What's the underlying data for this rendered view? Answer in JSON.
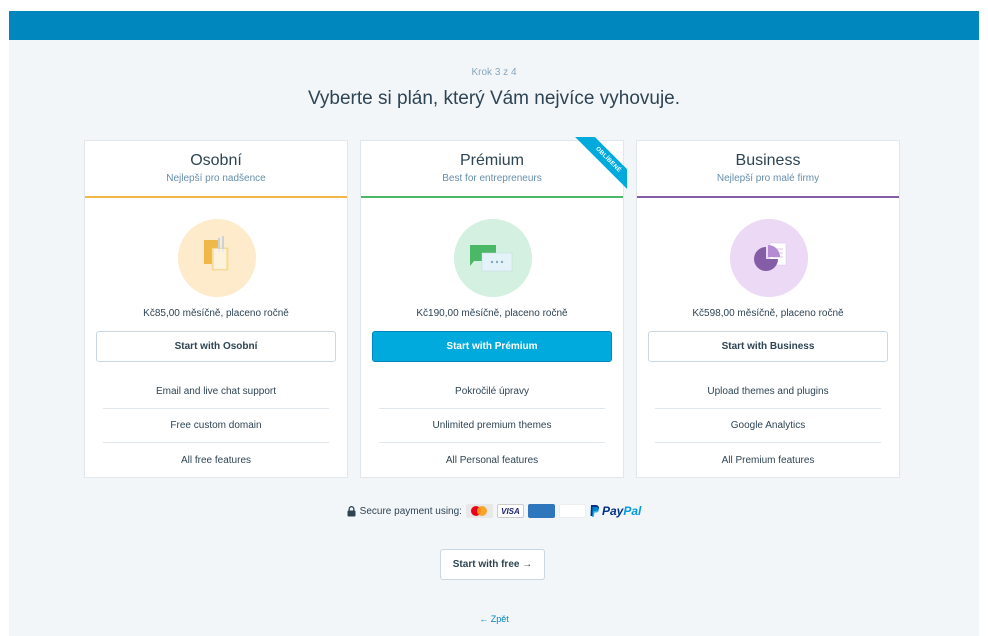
{
  "step": "Krok 3 z 4",
  "headline": "Vyberte si plán, který Vám nejvíce vyhovuje.",
  "plans": [
    {
      "name": "Osobní",
      "tagline": "Nejlepší pro nadšence",
      "price": "Kč85,00 měsíčně, placeno ročně",
      "button": "Start with Osobní",
      "accent": "#f0b849",
      "icon": "sticky-notes-icon",
      "features": [
        "Email and live chat support",
        "Free custom domain",
        "All free features"
      ]
    },
    {
      "name": "Prémium",
      "tagline": "Best for entrepreneurs",
      "price": "Kč190,00 měsíčně, placeno ročně",
      "button": "Start with Prémium",
      "accent": "#4ab866",
      "icon": "chat-bubbles-icon",
      "ribbon": "OBLÍBENÉ",
      "features": [
        "Pokročilé úpravy",
        "Unlimited premium themes",
        "All Personal features"
      ]
    },
    {
      "name": "Business",
      "tagline": "Nejlepší pro malé firmy",
      "price": "Kč598,00 měsíčně, placeno ročně",
      "button": "Start with Business",
      "accent": "#855da6",
      "icon": "pie-chart-document-icon",
      "features": [
        "Upload themes and plugins",
        "Google Analytics",
        "All Premium features"
      ]
    }
  ],
  "payment": {
    "label": "Secure payment using:",
    "methods": [
      "MasterCard",
      "VISA",
      "AMERICAN EXPRESS",
      "DISCOVER",
      "PayPal"
    ],
    "paypal_pay": "Pay",
    "paypal_pal": "Pal"
  },
  "free_button": "Start with free →",
  "back_link": "← Zpět",
  "colors": {
    "masthead": "#0087be",
    "background": "#f3f6f8",
    "primary_button": "#00aadc"
  }
}
